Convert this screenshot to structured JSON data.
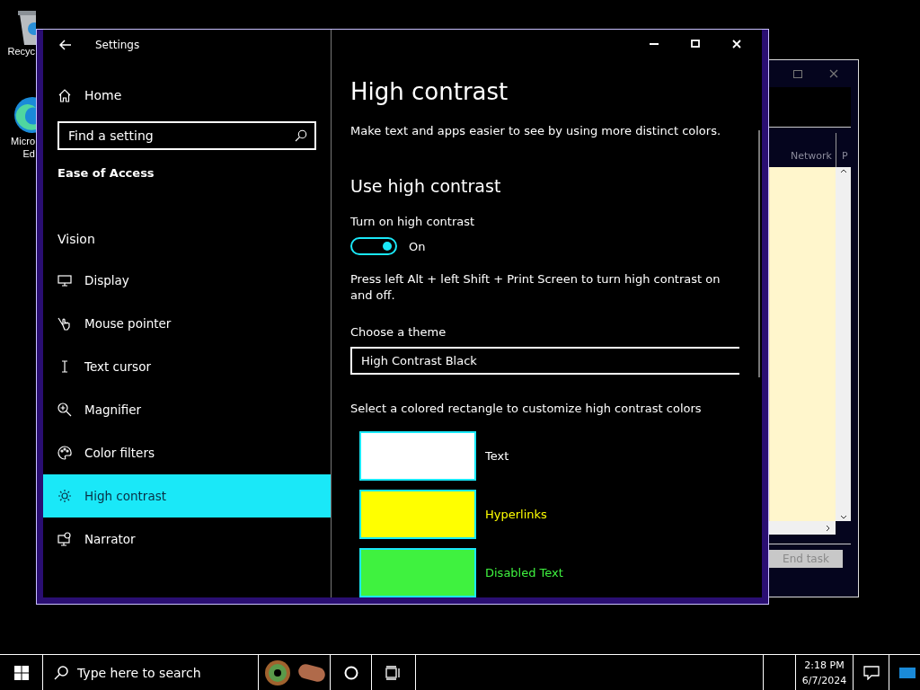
{
  "desktop_icons": [
    {
      "kind": "bin",
      "lines": [
        "Recyc"
      ]
    },
    {
      "kind": "browser",
      "lines": [
        "Micro",
        "Ed"
      ]
    }
  ],
  "task_manager": {
    "columns": [
      "Network",
      "P"
    ],
    "end_button": {
      "label": "End task",
      "disabled": true
    }
  },
  "settings": {
    "title": "Settings",
    "home": "Home",
    "search": {
      "placeholder": "Find a setting"
    },
    "section": "Ease of Access",
    "group": "Vision",
    "nav": [
      {
        "kind": "display",
        "label": "Display",
        "selected": false
      },
      {
        "kind": "pointer",
        "label": "Mouse pointer",
        "selected": false
      },
      {
        "kind": "cursor",
        "label": "Text cursor",
        "selected": false
      },
      {
        "kind": "magnifier",
        "label": "Magnifier",
        "selected": false
      },
      {
        "kind": "filters",
        "label": "Color filters",
        "selected": false
      },
      {
        "kind": "contrast",
        "label": "High contrast",
        "selected": true
      },
      {
        "kind": "narrator",
        "label": "Narrator",
        "selected": false
      }
    ],
    "page": {
      "heading": "High contrast",
      "description": "Make text and apps easier to see by using more distinct colors.",
      "subheading": "Use high contrast",
      "toggle": {
        "label": "Turn on high contrast",
        "on": true,
        "state_text": "On"
      },
      "hint": "Press left Alt + left Shift + Print Screen to turn high contrast on and off.",
      "theme": {
        "label": "Choose a theme",
        "value": "High Contrast Black"
      },
      "swatch_intro": "Select a colored rectangle to customize high contrast colors",
      "swatches": [
        {
          "label": "Text",
          "color": "#ffffff"
        },
        {
          "label": "Hyperlinks",
          "color": "#ffff00"
        },
        {
          "label": "Disabled Text",
          "color": "#3ff23f"
        }
      ]
    }
  },
  "taskbar": {
    "search_placeholder": "Type here to search",
    "time": "2:18 PM",
    "date": "6/7/2024"
  }
}
